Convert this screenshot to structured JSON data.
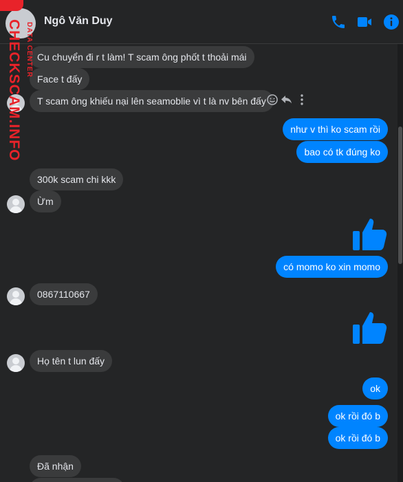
{
  "header": {
    "contact_name": "Ngô Văn Duy"
  },
  "watermark": {
    "main": "CHECKSCAM.INFO",
    "sub": "DATA CENTER"
  },
  "messages": [
    {
      "side": "in",
      "text": "Cu chuyển đi r t làm! T scam ông phốt t thoải mái"
    },
    {
      "side": "in",
      "text": "Face t đấy"
    },
    {
      "side": "in",
      "text": "T scam ông khiếu nại lên seamoblie vì t là nv bên đấy"
    },
    {
      "side": "out",
      "text": "như v thì ko scam rồi"
    },
    {
      "side": "out",
      "text": "bao có tk đúng ko"
    },
    {
      "side": "in",
      "text": "300k scam chi kkk"
    },
    {
      "side": "in",
      "text": "Ừm"
    },
    {
      "side": "out",
      "type": "like"
    },
    {
      "side": "out",
      "text": "có momo ko xin momo"
    },
    {
      "side": "in",
      "text": "0867110667"
    },
    {
      "side": "out",
      "type": "like"
    },
    {
      "side": "in",
      "text": "Họ tên t lun đấy"
    },
    {
      "side": "out",
      "text": "ok"
    },
    {
      "side": "out",
      "text": "ok rồi đó b"
    },
    {
      "side": "out",
      "text": "ok rồi đó b"
    },
    {
      "side": "in",
      "text": "Đã nhận"
    }
  ],
  "colors": {
    "accent": "#0084ff",
    "incoming_bubble": "#3a3b3c",
    "background": "#242526",
    "watermark": "#e8232a"
  },
  "icons": [
    "phone-icon",
    "video-icon",
    "info-icon",
    "emoji-icon",
    "reply-icon",
    "more-icon",
    "thumbs-up-icon"
  ]
}
